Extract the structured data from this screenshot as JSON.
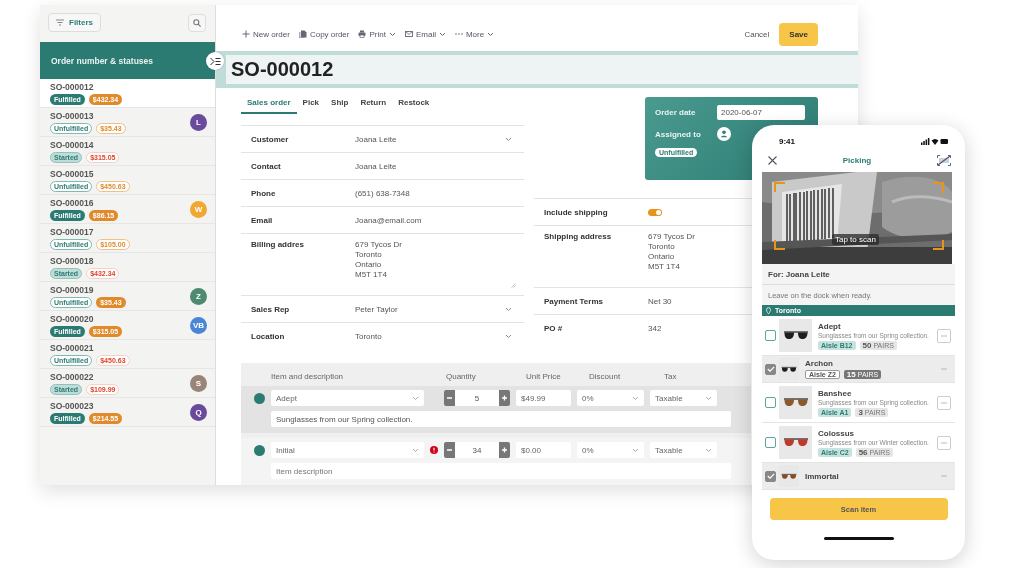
{
  "sidebar": {
    "filter_button": "Filters",
    "header": "Order number & statuses",
    "orders": [
      {
        "number": "SO-000012",
        "status": {
          "text": "Fulfilled",
          "kind": "filled"
        },
        "amount": {
          "text": "$432.34",
          "kind": "filled"
        },
        "selected": true
      },
      {
        "number": "SO-000013",
        "status": {
          "text": "Unfulfilled",
          "kind": "outline"
        },
        "amount": {
          "text": "$35.43",
          "kind": "outline"
        },
        "selected": false,
        "avatar": {
          "initial": "L",
          "color": "#6a4a9c"
        }
      },
      {
        "number": "SO-000014",
        "status": {
          "text": "Started",
          "kind": "light"
        },
        "amount": {
          "text": "$315.05",
          "kind": "red"
        },
        "selected": false
      },
      {
        "number": "SO-000015",
        "status": {
          "text": "Unfulfilled",
          "kind": "outline"
        },
        "amount": {
          "text": "$450.63",
          "kind": "outline"
        },
        "selected": false
      },
      {
        "number": "SO-000016",
        "status": {
          "text": "Fulfilled",
          "kind": "filled"
        },
        "amount": {
          "text": "$86.15",
          "kind": "filled"
        },
        "selected": false,
        "avatar": {
          "initial": "W",
          "color": "#f0a830"
        }
      },
      {
        "number": "SO-000017",
        "status": {
          "text": "Unfulfilled",
          "kind": "outline"
        },
        "amount": {
          "text": "$105.00",
          "kind": "outline"
        },
        "selected": false
      },
      {
        "number": "SO-000018",
        "status": {
          "text": "Started",
          "kind": "light"
        },
        "amount": {
          "text": "$432.34",
          "kind": "red"
        },
        "selected": false
      },
      {
        "number": "SO-000019",
        "status": {
          "text": "Unfulfilled",
          "kind": "outline"
        },
        "amount": {
          "text": "$35.43",
          "kind": "filled"
        },
        "selected": false,
        "avatar": {
          "initial": "Z",
          "color": "#4e8a72"
        }
      },
      {
        "number": "SO-000020",
        "status": {
          "text": "Fulfilled",
          "kind": "filled"
        },
        "amount": {
          "text": "$315.05",
          "kind": "filled"
        },
        "selected": false,
        "avatar": {
          "initial": "VB",
          "color": "#4a86d8"
        }
      },
      {
        "number": "SO-000021",
        "status": {
          "text": "Unfulfilled",
          "kind": "outline"
        },
        "amount": {
          "text": "$450.63",
          "kind": "red"
        },
        "selected": false
      },
      {
        "number": "SO-000022",
        "status": {
          "text": "Started",
          "kind": "light"
        },
        "amount": {
          "text": "$109.99",
          "kind": "red"
        },
        "selected": false,
        "avatar": {
          "initial": "S",
          "color": "#9a8478"
        }
      },
      {
        "number": "SO-000023",
        "status": {
          "text": "Fulfilled",
          "kind": "filled"
        },
        "amount": {
          "text": "$214.55",
          "kind": "filled"
        },
        "selected": false,
        "avatar": {
          "initial": "Q",
          "color": "#6a4a9c"
        }
      }
    ]
  },
  "toolbar": {
    "actions": [
      {
        "label": "New order",
        "dropdown": false
      },
      {
        "label": "Copy order",
        "dropdown": false
      },
      {
        "label": "Print",
        "dropdown": true
      },
      {
        "label": "Email",
        "dropdown": true
      },
      {
        "label": "More",
        "dropdown": true
      }
    ],
    "cancel": "Cancel",
    "save": "Save"
  },
  "order_title": "SO-000012",
  "tabs": [
    {
      "label": "Sales order",
      "selected": true
    },
    {
      "label": "Pick",
      "selected": false
    },
    {
      "label": "Ship",
      "selected": false
    },
    {
      "label": "Return",
      "selected": false
    },
    {
      "label": "Restock",
      "selected": false
    }
  ],
  "summary": {
    "order_date_label": "Order date",
    "order_date": "2020-06-07",
    "assigned_label": "Assigned to",
    "status": "Unfulfilled"
  },
  "form_left": [
    {
      "label": "Customer",
      "kind": "select",
      "value": "Joana Leite"
    },
    {
      "label": "Contact",
      "kind": "text",
      "value": "Joana Leite"
    },
    {
      "label": "Phone",
      "kind": "text",
      "value": "(651) 638-7348"
    },
    {
      "label": "Email",
      "kind": "text",
      "value": "Joana@email.com"
    },
    {
      "label": "Billing addres",
      "kind": "textarea",
      "lines": [
        "679 Tycos Dr",
        "Toronto",
        "Ontario",
        "M5T 1T4"
      ]
    },
    {
      "label": "Sales Rep",
      "kind": "select",
      "value": "Peter Taylor"
    },
    {
      "label": "Location",
      "kind": "select",
      "value": "Toronto"
    }
  ],
  "form_right": [
    {
      "label": "Include shipping",
      "kind": "toggle",
      "on": true
    },
    {
      "label": "Shipping address",
      "kind": "address",
      "lines": [
        "679 Tycos Dr",
        "Toronto",
        "Ontario",
        "M5T 1T4"
      ]
    },
    {
      "label": "Payment Terms",
      "kind": "text",
      "value": "Net 30"
    },
    {
      "label": "PO #",
      "kind": "text",
      "value": "342"
    }
  ],
  "line_items": {
    "columns": [
      "Item and description",
      "Quantity",
      "Unit Price",
      "Discount",
      "Tax"
    ],
    "rows": [
      {
        "item": "Adept",
        "description": "Sunglasses from our Spring collection.",
        "quantity": "5",
        "price": "$49.99",
        "discount": "0%",
        "tax": "Taxable",
        "error": false,
        "selected": true
      },
      {
        "item": "Initial",
        "description_placeholder": "Item description",
        "quantity": "34",
        "price": "$0.00",
        "discount": "0%",
        "tax": "Taxable",
        "error": true,
        "selected": false
      }
    ]
  },
  "phone": {
    "time": "9:41",
    "title": "Picking",
    "camera_hint": "Tap to scan",
    "customer": "For: Joana Leite",
    "note": "Leave on the dock when ready.",
    "location": "Toronto",
    "items": [
      {
        "name": "Adept",
        "description": "Sunglasses from our Spring collection.",
        "aisle": "Aisle B12",
        "quantity": "50",
        "unit": "PAIRS",
        "checked": false,
        "color": "#1e1e1e"
      },
      {
        "name": "Archon",
        "aisle": "Aisle Z2",
        "quantity": "15",
        "unit": "PAIRS",
        "checked": true,
        "color": "#1e1e1e"
      },
      {
        "name": "Banshee",
        "description": "Sunglasses from our Spring collection.",
        "aisle": "Aisle A1",
        "quantity": "3",
        "unit": "PAIRS",
        "checked": false,
        "color": "#8a5a2e"
      },
      {
        "name": "Colossus",
        "description": "Sunglasses from our Winter collection.",
        "aisle": "Aisle C2",
        "quantity": "56",
        "unit": "PAIRS",
        "checked": false,
        "color": "#c0392b"
      },
      {
        "name": "Immortal",
        "checked": true,
        "color": "#8a4a22"
      }
    ],
    "button": "Scan item"
  }
}
